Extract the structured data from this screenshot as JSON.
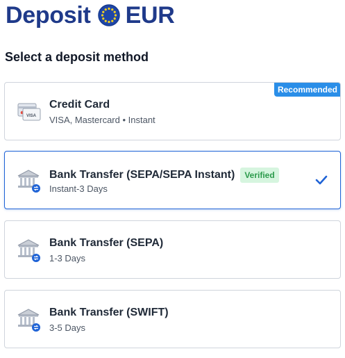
{
  "header": {
    "title_word1": "Deposit",
    "title_word2": "EUR",
    "flag_icon": "eu-flag-icon"
  },
  "subtitle": "Select a deposit method",
  "colors": {
    "brand": "#1f3a8a",
    "accent": "#1f63d6",
    "recommended_badge": "#2a8ee8",
    "verified_bg": "#d6f5df",
    "verified_text": "#2b9a4b"
  },
  "methods": [
    {
      "name": "Credit Card",
      "sub": "VISA, Mastercard • Instant",
      "badge": "Recommended",
      "icon": "credit-card-icon",
      "selected": false
    },
    {
      "name": "Bank Transfer (SEPA/SEPA Instant)",
      "sub": "Instant-3 Days",
      "tag": "Verified",
      "icon": "bank-icon",
      "selected": true
    },
    {
      "name": "Bank Transfer (SEPA)",
      "sub": "1-3 Days",
      "icon": "bank-icon",
      "selected": false
    },
    {
      "name": "Bank Transfer (SWIFT)",
      "sub": "3-5 Days",
      "icon": "bank-icon",
      "selected": false
    }
  ]
}
